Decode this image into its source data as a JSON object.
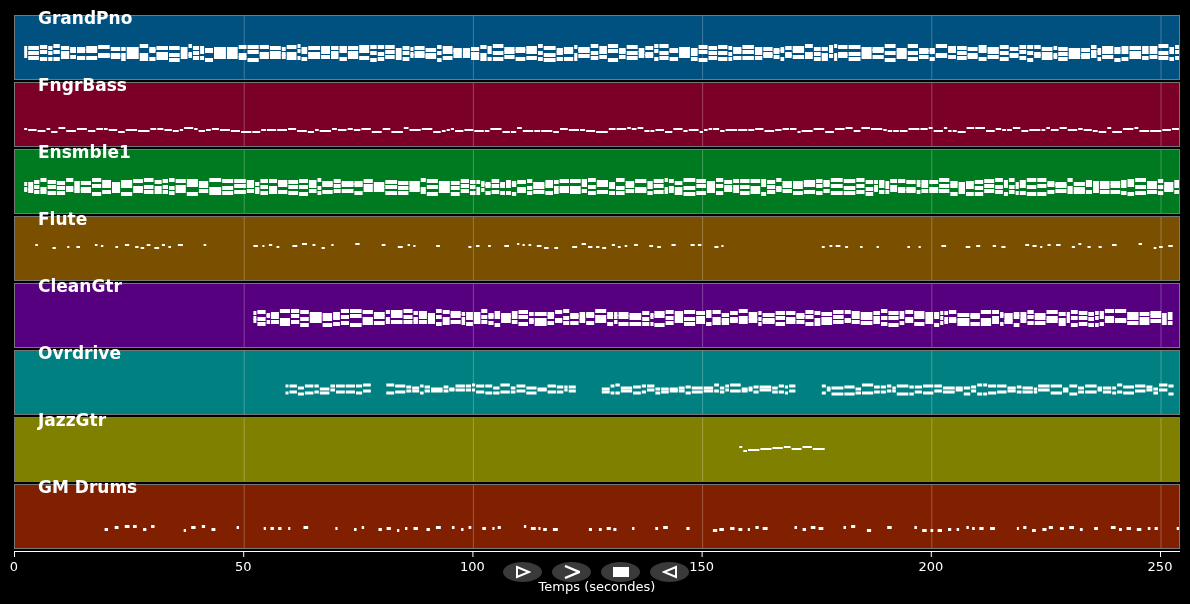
{
  "tracks": [
    {
      "name": "GrandPno",
      "color": "#005080"
    },
    {
      "name": "FngrBass",
      "color": "#7a0028"
    },
    {
      "name": "Ensmble1",
      "color": "#007a20"
    },
    {
      "name": "Flute",
      "color": "#7a5000"
    },
    {
      "name": "CleanGtr",
      "color": "#560080"
    },
    {
      "name": "Ovrdrive",
      "color": "#008080"
    },
    {
      "name": "JazzGtr",
      "color": "#808000"
    },
    {
      "name": "GM Drums",
      "color": "#802000"
    }
  ],
  "axis": {
    "ticks": [
      "0",
      "50",
      "100",
      "150",
      "200",
      "250"
    ],
    "label": "Temps (secondes)"
  },
  "controls": [
    {
      "kind": "play"
    },
    {
      "kind": "forward"
    },
    {
      "kind": "stop"
    },
    {
      "kind": "reverse"
    }
  ]
}
